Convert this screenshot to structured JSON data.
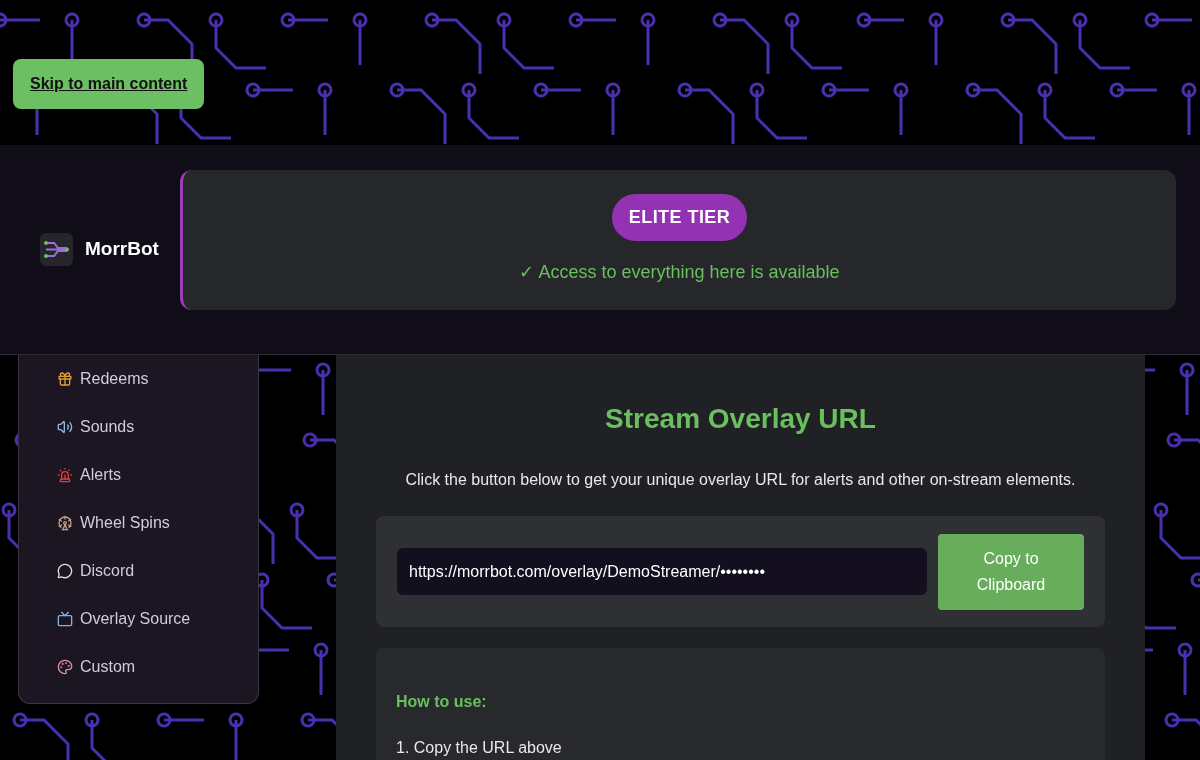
{
  "skip_link": "Skip to main content",
  "brand": {
    "name": "MorrBot"
  },
  "tier": {
    "badge": "ELITE TIER",
    "message": "✓ Access to everything here is available"
  },
  "sidebar": {
    "items": [
      {
        "label": "Redeems"
      },
      {
        "label": "Sounds"
      },
      {
        "label": "Alerts"
      },
      {
        "label": "Wheel Spins"
      },
      {
        "label": "Discord"
      },
      {
        "label": "Overlay Source"
      },
      {
        "label": "Custom"
      }
    ]
  },
  "main": {
    "title": "Stream Overlay URL",
    "description": "Click the button below to get your unique overlay URL for alerts and other on-stream elements.",
    "url_field": {
      "value": "https://morrbot.com/overlay/DemoStreamer/••••••••"
    },
    "copy_button": "Copy to Clipboard",
    "how_to": {
      "heading": "How to use:",
      "steps": [
        "1. Copy the URL above"
      ]
    }
  }
}
